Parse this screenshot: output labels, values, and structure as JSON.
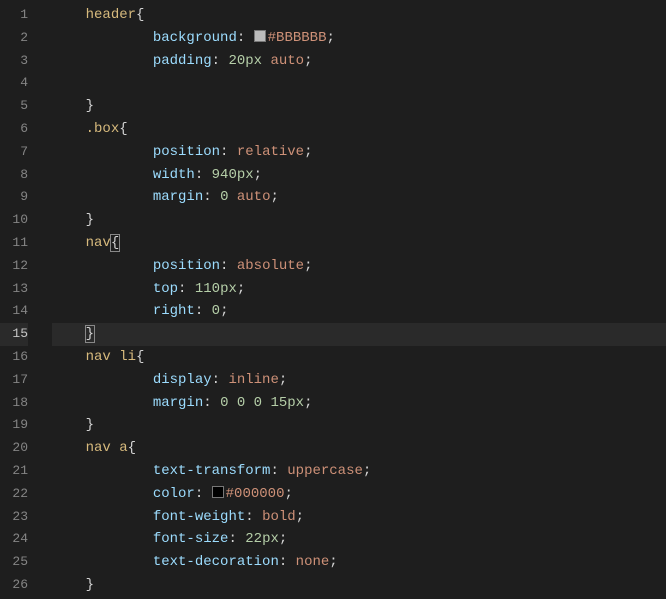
{
  "lines": [
    {
      "n": 1,
      "seg": [
        [
          "sel",
          "header"
        ],
        [
          "punct",
          "{"
        ]
      ]
    },
    {
      "n": 2,
      "indent": 2,
      "seg": [
        [
          "prop",
          "background"
        ],
        [
          "colon",
          ": "
        ],
        [
          "swatch",
          "#BBBBBB"
        ],
        [
          "val",
          "#BBBBBB"
        ],
        [
          "punct",
          ";"
        ]
      ]
    },
    {
      "n": 3,
      "indent": 2,
      "seg": [
        [
          "prop",
          "padding"
        ],
        [
          "colon",
          ": "
        ],
        [
          "num",
          "20px"
        ],
        [
          "val",
          " auto"
        ],
        [
          "punct",
          ";"
        ]
      ]
    },
    {
      "n": 4,
      "seg": []
    },
    {
      "n": 5,
      "seg": [
        [
          "punct",
          "}"
        ]
      ]
    },
    {
      "n": 6,
      "seg": [
        [
          "sel",
          ".box"
        ],
        [
          "punct",
          "{"
        ]
      ]
    },
    {
      "n": 7,
      "indent": 2,
      "seg": [
        [
          "prop",
          "position"
        ],
        [
          "colon",
          ": "
        ],
        [
          "val",
          "relative"
        ],
        [
          "punct",
          ";"
        ]
      ]
    },
    {
      "n": 8,
      "indent": 2,
      "seg": [
        [
          "prop",
          "width"
        ],
        [
          "colon",
          ": "
        ],
        [
          "num",
          "940px"
        ],
        [
          "punct",
          ";"
        ]
      ]
    },
    {
      "n": 9,
      "indent": 2,
      "seg": [
        [
          "prop",
          "margin"
        ],
        [
          "colon",
          ": "
        ],
        [
          "num",
          "0"
        ],
        [
          "val",
          " auto"
        ],
        [
          "punct",
          ";"
        ]
      ]
    },
    {
      "n": 10,
      "seg": [
        [
          "punct",
          "}"
        ]
      ]
    },
    {
      "n": 11,
      "seg": [
        [
          "sel",
          "nav"
        ],
        [
          "bracematch",
          "{"
        ]
      ]
    },
    {
      "n": 12,
      "indent": 2,
      "seg": [
        [
          "prop",
          "position"
        ],
        [
          "colon",
          ": "
        ],
        [
          "val",
          "absolute"
        ],
        [
          "punct",
          ";"
        ]
      ]
    },
    {
      "n": 13,
      "indent": 2,
      "seg": [
        [
          "prop",
          "top"
        ],
        [
          "colon",
          ": "
        ],
        [
          "num",
          "110px"
        ],
        [
          "punct",
          ";"
        ]
      ]
    },
    {
      "n": 14,
      "indent": 2,
      "seg": [
        [
          "prop",
          "right"
        ],
        [
          "colon",
          ": "
        ],
        [
          "num",
          "0"
        ],
        [
          "punct",
          ";"
        ]
      ]
    },
    {
      "n": 15,
      "hl": true,
      "seg": [
        [
          "bracematch",
          "}"
        ]
      ]
    },
    {
      "n": 16,
      "seg": [
        [
          "sel",
          "nav li"
        ],
        [
          "punct",
          "{"
        ]
      ]
    },
    {
      "n": 17,
      "indent": 2,
      "seg": [
        [
          "prop",
          "display"
        ],
        [
          "colon",
          ": "
        ],
        [
          "val",
          "inline"
        ],
        [
          "punct",
          ";"
        ]
      ]
    },
    {
      "n": 18,
      "indent": 2,
      "seg": [
        [
          "prop",
          "margin"
        ],
        [
          "colon",
          ": "
        ],
        [
          "num",
          "0 0 0 15px"
        ],
        [
          "punct",
          ";"
        ]
      ]
    },
    {
      "n": 19,
      "seg": [
        [
          "punct",
          "}"
        ]
      ]
    },
    {
      "n": 20,
      "seg": [
        [
          "sel",
          "nav a"
        ],
        [
          "punct",
          "{"
        ]
      ]
    },
    {
      "n": 21,
      "indent": 2,
      "seg": [
        [
          "prop",
          "text-transform"
        ],
        [
          "colon",
          ": "
        ],
        [
          "val",
          "uppercase"
        ],
        [
          "punct",
          ";"
        ]
      ]
    },
    {
      "n": 22,
      "indent": 2,
      "seg": [
        [
          "prop",
          "color"
        ],
        [
          "colon",
          ": "
        ],
        [
          "swatch",
          "#000000"
        ],
        [
          "val",
          "#000000"
        ],
        [
          "punct",
          ";"
        ]
      ]
    },
    {
      "n": 23,
      "indent": 2,
      "seg": [
        [
          "prop",
          "font-weight"
        ],
        [
          "colon",
          ": "
        ],
        [
          "val",
          "bold"
        ],
        [
          "punct",
          ";"
        ]
      ]
    },
    {
      "n": 24,
      "indent": 2,
      "seg": [
        [
          "prop",
          "font-size"
        ],
        [
          "colon",
          ": "
        ],
        [
          "num",
          "22px"
        ],
        [
          "punct",
          ";"
        ]
      ]
    },
    {
      "n": 25,
      "indent": 2,
      "seg": [
        [
          "prop",
          "text-decoration"
        ],
        [
          "colon",
          ": "
        ],
        [
          "val",
          "none"
        ],
        [
          "punct",
          ";"
        ]
      ]
    },
    {
      "n": 26,
      "seg": [
        [
          "punct",
          "}"
        ]
      ]
    }
  ]
}
